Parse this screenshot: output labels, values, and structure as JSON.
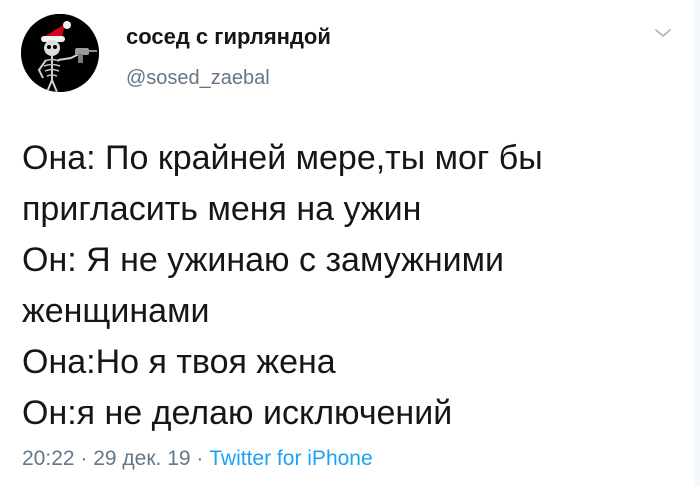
{
  "author": {
    "display_name": "сосед с гирляндой",
    "handle": "@sosed_zaebal"
  },
  "icons": {
    "avatar": "skeleton-with-drill-santa-hat",
    "menu": "chevron-down-icon"
  },
  "tweet": {
    "lines": [
      "Она: По крайней мере,ты мог бы",
      "пригласить меня на ужин",
      "Он: Я не ужинаю с замужними",
      "женщинами",
      "Она:Но я твоя жена",
      "Он:я не делаю исключений"
    ]
  },
  "meta": {
    "time": "20:22",
    "sep1": " · ",
    "date": "29 дек. 19",
    "sep2": " · ",
    "source": "Twitter for iPhone"
  },
  "colors": {
    "text": "#14171a",
    "secondary": "#657786",
    "link": "#1da1f2",
    "santa_hat": "#d0021b"
  }
}
